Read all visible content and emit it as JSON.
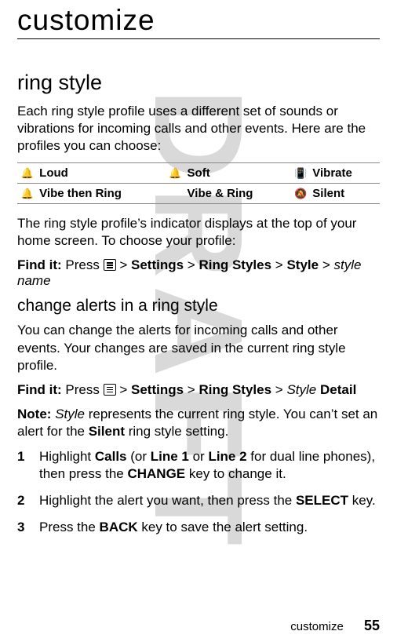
{
  "watermark": "DRAFT",
  "title": "customize",
  "section1": {
    "heading": "ring style",
    "intro": "Each ring style profile uses a different set of sounds or vibrations for incoming calls and other events. Here are the profiles you can choose:",
    "profiles": {
      "row1": [
        {
          "icon": "🔔",
          "label": "Loud"
        },
        {
          "icon": "🔔",
          "label": "Soft"
        },
        {
          "icon": "📳",
          "label": "Vibrate"
        }
      ],
      "row2": [
        {
          "icon": "🔔",
          "label": "Vibe then Ring"
        },
        {
          "icon": "",
          "label": "Vibe & Ring"
        },
        {
          "icon": "🔕",
          "label": "Silent"
        }
      ]
    },
    "after_table": "The ring style profile’s indicator displays at the top of your home screen. To choose your profile:",
    "findit_prefix": "Find it:",
    "findit_press": "Press",
    "findit_path": {
      "settings": "Settings",
      "ring_styles": "Ring Styles",
      "style": "Style",
      "style_name": "style name"
    }
  },
  "section2": {
    "heading": "change alerts in a ring style",
    "intro": "You can change the alerts for incoming calls and other events. Your changes are saved in the current ring style profile.",
    "findit_prefix": "Find it:",
    "findit_press": "Press",
    "findit_path": {
      "settings": "Settings",
      "ring_styles": "Ring Styles",
      "style": "Style",
      "detail": "Detail"
    },
    "note_prefix": "Note:",
    "note_style": "Style",
    "note_text1": " represents the current ring style. You can’t set an alert for the ",
    "note_silent": "Silent",
    "note_text2": " ring style setting.",
    "steps": {
      "s1_a": "Highlight ",
      "s1_calls": "Calls",
      "s1_b": " (or ",
      "s1_line1": "Line 1",
      "s1_c": " or ",
      "s1_line2": "Line 2",
      "s1_d": " for dual line phones), then press the ",
      "s1_change": "CHANGE",
      "s1_e": " key to change it.",
      "s2_a": "Highlight the alert you want, then press the ",
      "s2_select": "SELECT",
      "s2_b": " key.",
      "s3_a": "Press the ",
      "s3_back": "BACK",
      "s3_b": " key to save the alert setting."
    }
  },
  "footer": {
    "label": "customize",
    "page": "55"
  },
  "gt": ">"
}
